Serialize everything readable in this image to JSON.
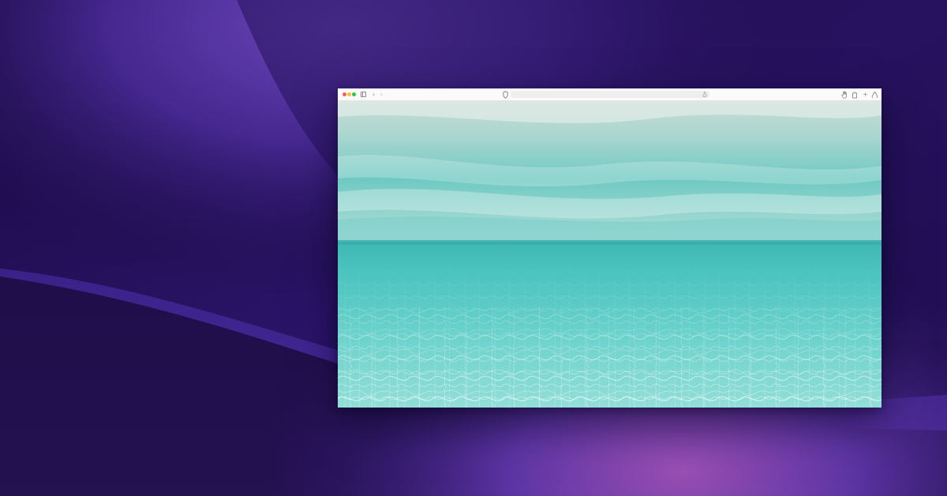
{
  "colors": {
    "wallpaper_dark": "#140838",
    "wallpaper_mid": "#3a1f86",
    "wallpaper_light": "#5a3aa8",
    "wallpaper_glow": "#8f4fb0",
    "traffic_close": "#fd5f57",
    "traffic_minimize": "#febc2e",
    "traffic_maximize": "#28c840",
    "water_surface": "#9fd9d2",
    "water_deep": "#41c2bd",
    "water_floor": "#7fdad4"
  },
  "browser": {
    "icons": {
      "close": "close-dot",
      "minimize": "minimize-dot",
      "maximize": "maximize-dot",
      "sidebar": "sidebar-icon",
      "back": "chevron-left-icon",
      "forward": "chevron-right-icon",
      "privacy": "shield-icon",
      "share": "share-icon",
      "hand": "hand-icon",
      "extension": "puzzle-icon",
      "menu": "more-icon",
      "downloads": "download-icon"
    },
    "back_glyph": "‹",
    "forward_glyph": "›",
    "plus_glyph": "+",
    "address_value": ""
  },
  "content": {
    "scene": "underwater-photo"
  }
}
